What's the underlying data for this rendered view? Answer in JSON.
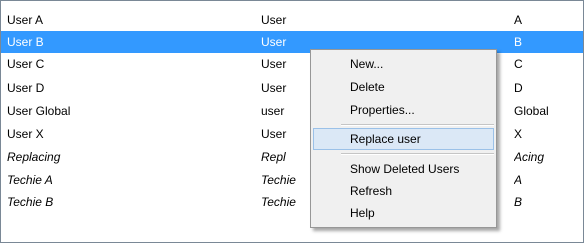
{
  "rows": [
    {
      "name": "User A",
      "type": "User",
      "short": "A"
    },
    {
      "name": "User B",
      "type": "User",
      "short": "B"
    },
    {
      "name": "User C",
      "type": "User",
      "short": "C"
    },
    {
      "name": "User D",
      "type": "User",
      "short": "D"
    },
    {
      "name": "User Global",
      "type": "user",
      "short": "Global"
    },
    {
      "name": "User X",
      "type": "User",
      "short": "X"
    },
    {
      "name": "Replacing",
      "type": "Repl",
      "short": "Acing"
    },
    {
      "name": "Techie A",
      "type": "Techie",
      "short": "A"
    },
    {
      "name": "Techie B",
      "type": "Techie",
      "short": "B"
    }
  ],
  "context_menu": {
    "new": "New...",
    "delete": "Delete",
    "properties": "Properties...",
    "replace_user": "Replace user",
    "show_deleted_users": "Show Deleted Users",
    "refresh": "Refresh",
    "help": "Help"
  },
  "colors": {
    "selection": "#3399ff",
    "menu_background": "#f0f0f0",
    "menu_highlight": "#dbe8f6"
  }
}
